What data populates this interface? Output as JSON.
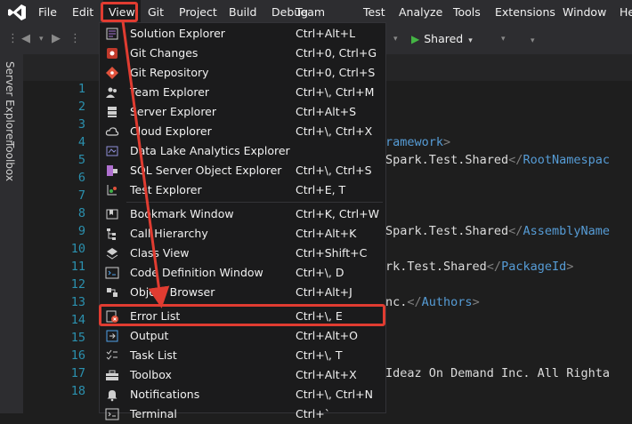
{
  "menubar": {
    "items": [
      {
        "label": "File"
      },
      {
        "label": "Edit"
      },
      {
        "label": "View"
      },
      {
        "label": "Git"
      },
      {
        "label": "Project"
      },
      {
        "label": "Build"
      },
      {
        "label": "Debug"
      },
      {
        "label": "Team"
      },
      {
        "label": "Test"
      },
      {
        "label": "Analyze"
      },
      {
        "label": "Tools"
      },
      {
        "label": "Extensions"
      },
      {
        "label": "Window"
      },
      {
        "label": "He"
      }
    ]
  },
  "toolbar": {
    "shared_label": "Shared"
  },
  "side_tabs": {
    "server_explorer": "Server Explorer",
    "toolbox": "Toolbox"
  },
  "view_menu": {
    "items": [
      {
        "label": "Solution Explorer",
        "shortcut": "Ctrl+Alt+L",
        "icon": "solution-explorer-icon"
      },
      {
        "label": "Git Changes",
        "shortcut": "Ctrl+0, Ctrl+G",
        "icon": "git-changes-icon"
      },
      {
        "label": "Git Repository",
        "shortcut": "Ctrl+0, Ctrl+S",
        "icon": "git-repository-icon"
      },
      {
        "label": "Team Explorer",
        "shortcut": "Ctrl+\\, Ctrl+M",
        "icon": "team-explorer-icon"
      },
      {
        "label": "Server Explorer",
        "shortcut": "Ctrl+Alt+S",
        "icon": "server-explorer-icon"
      },
      {
        "label": "Cloud Explorer",
        "shortcut": "Ctrl+\\, Ctrl+X",
        "icon": "cloud-icon"
      },
      {
        "label": "Data Lake Analytics Explorer",
        "shortcut": "",
        "icon": "data-lake-icon"
      },
      {
        "label": "SQL Server Object Explorer",
        "shortcut": "Ctrl+\\, Ctrl+S",
        "icon": "sql-server-icon"
      },
      {
        "label": "Test Explorer",
        "shortcut": "Ctrl+E, T",
        "icon": "test-explorer-icon"
      },
      {
        "label": "Bookmark Window",
        "shortcut": "Ctrl+K, Ctrl+W",
        "icon": "bookmark-icon"
      },
      {
        "label": "Call Hierarchy",
        "shortcut": "Ctrl+Alt+K",
        "icon": "call-hierarchy-icon"
      },
      {
        "label": "Class View",
        "shortcut": "Ctrl+Shift+C",
        "icon": "class-view-icon"
      },
      {
        "label": "Code Definition Window",
        "shortcut": "Ctrl+\\, D",
        "icon": "code-definition-icon"
      },
      {
        "label": "Object Browser",
        "shortcut": "Ctrl+Alt+J",
        "icon": "object-browser-icon"
      },
      {
        "label": "Error List",
        "shortcut": "Ctrl+\\, E",
        "icon": "error-list-icon"
      },
      {
        "label": "Output",
        "shortcut": "Ctrl+Alt+O",
        "icon": "output-icon"
      },
      {
        "label": "Task List",
        "shortcut": "Ctrl+\\, T",
        "icon": "task-list-icon"
      },
      {
        "label": "Toolbox",
        "shortcut": "Ctrl+Alt+X",
        "icon": "toolbox-icon"
      },
      {
        "label": "Notifications",
        "shortcut": "Ctrl+\\, Ctrl+N",
        "icon": "bell-icon"
      },
      {
        "label": "Terminal",
        "shortcut": "Ctrl+`",
        "icon": "terminal-icon"
      }
    ]
  },
  "editor": {
    "line_numbers": [
      "1",
      "2",
      "3",
      "4",
      "5",
      "6",
      "7",
      "8",
      "9",
      "10",
      "11",
      "12",
      "13",
      "14",
      "15",
      "16",
      "17",
      "18"
    ],
    "code_fragments": {
      "line4": {
        "text": "ramework",
        "close": ">"
      },
      "line5": {
        "text": "Spark.Test.Shared",
        "tag": "RootNamespac"
      },
      "line9": {
        "text": "Spark.Test.Shared",
        "tag": "AssemblyName"
      },
      "line11": {
        "text": "rk.Test.Shared",
        "tag": "PackageId"
      },
      "line13": {
        "text": "nc.",
        "tag": "Authors"
      },
      "line17": {
        "text": "Ideaz On Demand Inc. All Righta"
      }
    }
  },
  "colors": {
    "highlight": "#e03c31",
    "line_number": "#2b91af",
    "xml_tag": "#569cd6"
  }
}
